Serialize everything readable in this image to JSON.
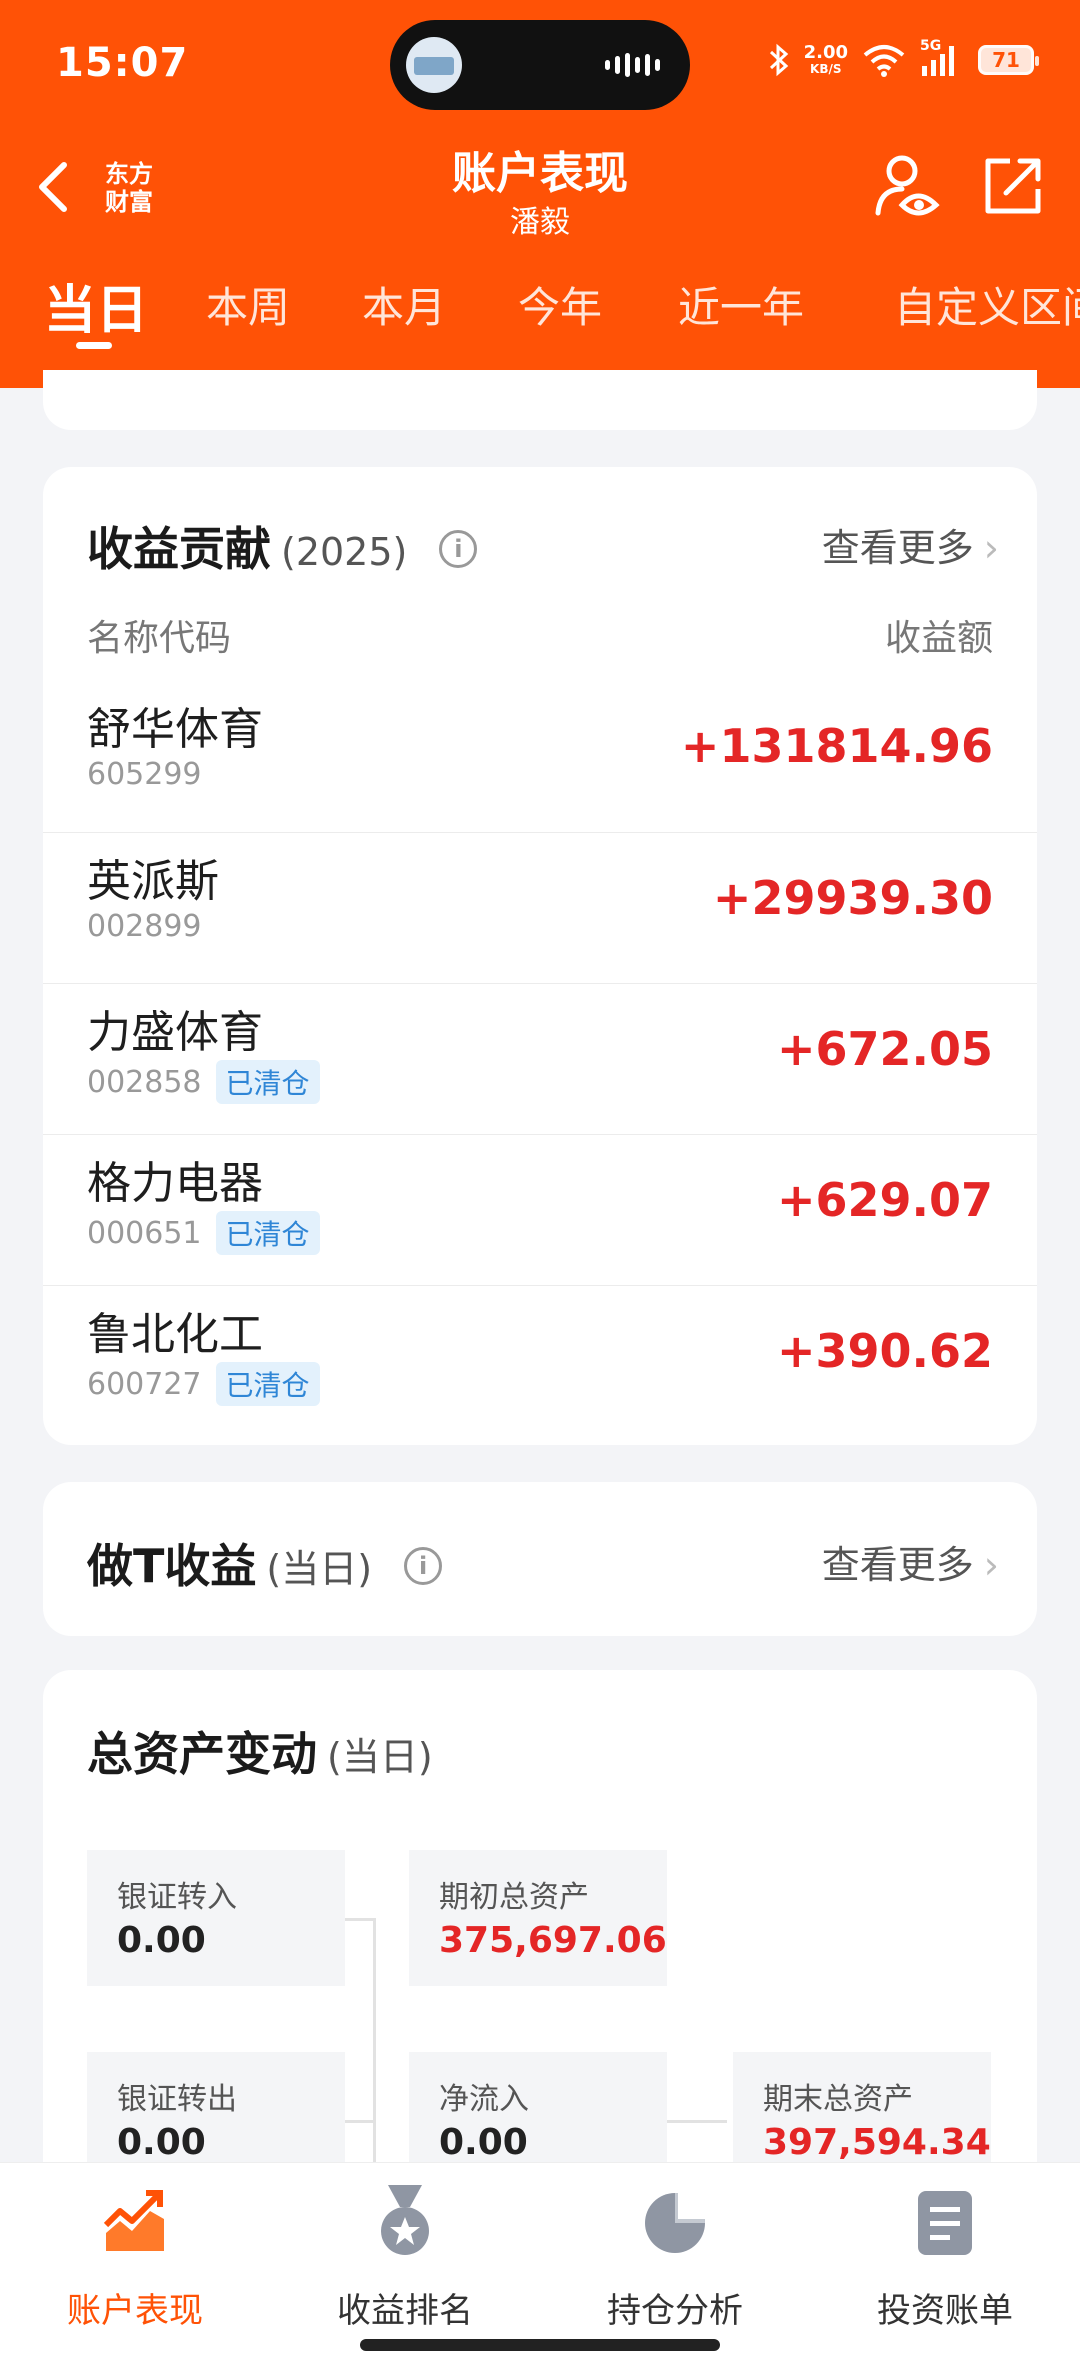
{
  "status": {
    "time": "15:07",
    "net_speed": "2.00",
    "net_unit": "KB/S",
    "network": "5G",
    "battery": "71"
  },
  "nav": {
    "logo_line1": "东方",
    "logo_line2": "财富",
    "title": "账户表现",
    "subtitle": "潘毅"
  },
  "tabs": [
    "当日",
    "本周",
    "本月",
    "今年",
    "近一年",
    "自定义区间"
  ],
  "contribution": {
    "title": "收益贡献",
    "year": "(2025)",
    "info_glyph": "i",
    "more": "查看更多",
    "col_name": "名称代码",
    "col_value": "收益额",
    "rows": [
      {
        "name": "舒华体育",
        "code": "605299",
        "badge": "",
        "value": "+131814.96"
      },
      {
        "name": "英派斯",
        "code": "002899",
        "badge": "",
        "value": "+29939.30"
      },
      {
        "name": "力盛体育",
        "code": "002858",
        "badge": "已清仓",
        "value": "+672.05"
      },
      {
        "name": "格力电器",
        "code": "000651",
        "badge": "已清仓",
        "value": "+629.07"
      },
      {
        "name": "鲁北化工",
        "code": "600727",
        "badge": "已清仓",
        "value": "+390.62"
      }
    ]
  },
  "t_profit": {
    "title": "做T收益",
    "period": "(当日)",
    "info_glyph": "i",
    "more": "查看更多"
  },
  "assets": {
    "title": "总资产变动",
    "period": "(当日)",
    "bank_in_label": "银证转入",
    "bank_in_value": "0.00",
    "start_label": "期初总资产",
    "start_value": "375,697.06",
    "bank_out_label": "银证转出",
    "bank_out_value": "0.00",
    "net_in_label": "净流入",
    "net_in_value": "0.00",
    "end_label": "期末总资产",
    "end_value": "397,594.34"
  },
  "bottom_nav": [
    {
      "label": "账户表现",
      "icon": "trend-chart-icon",
      "active": true
    },
    {
      "label": "收益排名",
      "icon": "medal-icon",
      "active": false
    },
    {
      "label": "持仓分析",
      "icon": "pie-chart-icon",
      "active": false
    },
    {
      "label": "投资账单",
      "icon": "bill-icon",
      "active": false
    }
  ],
  "colors": {
    "brand": "#ff5206",
    "profit_red": "#e42626",
    "badge_blue": "#2f86d6"
  }
}
